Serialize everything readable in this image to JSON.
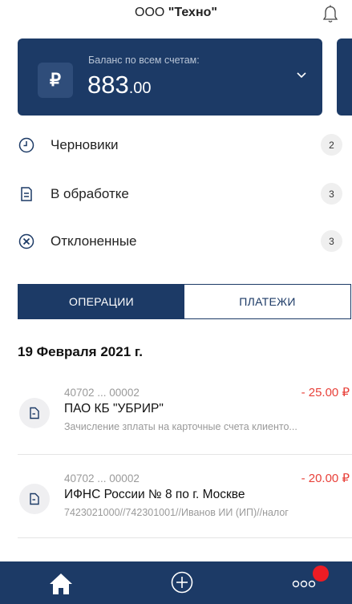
{
  "header": {
    "company_prefix": "ООО ",
    "company_name": "\"Техно\""
  },
  "balance_card": {
    "currency_symbol": "₽",
    "label": "Баланс по всем счетам:",
    "amount_main": "883",
    "amount_cents": ".00"
  },
  "statuses": [
    {
      "label": "Черновики",
      "count": "2",
      "icon": "clock-icon"
    },
    {
      "label": "В обработке",
      "count": "3",
      "icon": "document-icon"
    },
    {
      "label": "Отклоненные",
      "count": "3",
      "icon": "cross-circle-icon"
    }
  ],
  "tabs": {
    "operations": "ОПЕРАЦИИ",
    "payments": "ПЛАТЕЖИ",
    "active": "operations"
  },
  "date_header": "19 Февраля 2021 г.",
  "operations": [
    {
      "account": "40702 ... 00002",
      "amount": "- 25.00 ₽",
      "name": "ПАО КБ \"УБРИР\"",
      "description": "Зачисление зплаты на карточные счета клиенто..."
    },
    {
      "account": "40702 ... 00002",
      "amount": "- 20.00 ₽",
      "name": "ИФНС России № 8 по г. Москве",
      "description": "7423021000//742301001//Иванов ИИ (ИП)//налог"
    }
  ],
  "tabbar": {
    "items": [
      "home-icon",
      "add-icon",
      "more-icon"
    ]
  },
  "colors": {
    "brand": "#1c3a66",
    "negative": "#e8413a",
    "notification": "#ec1c24"
  }
}
